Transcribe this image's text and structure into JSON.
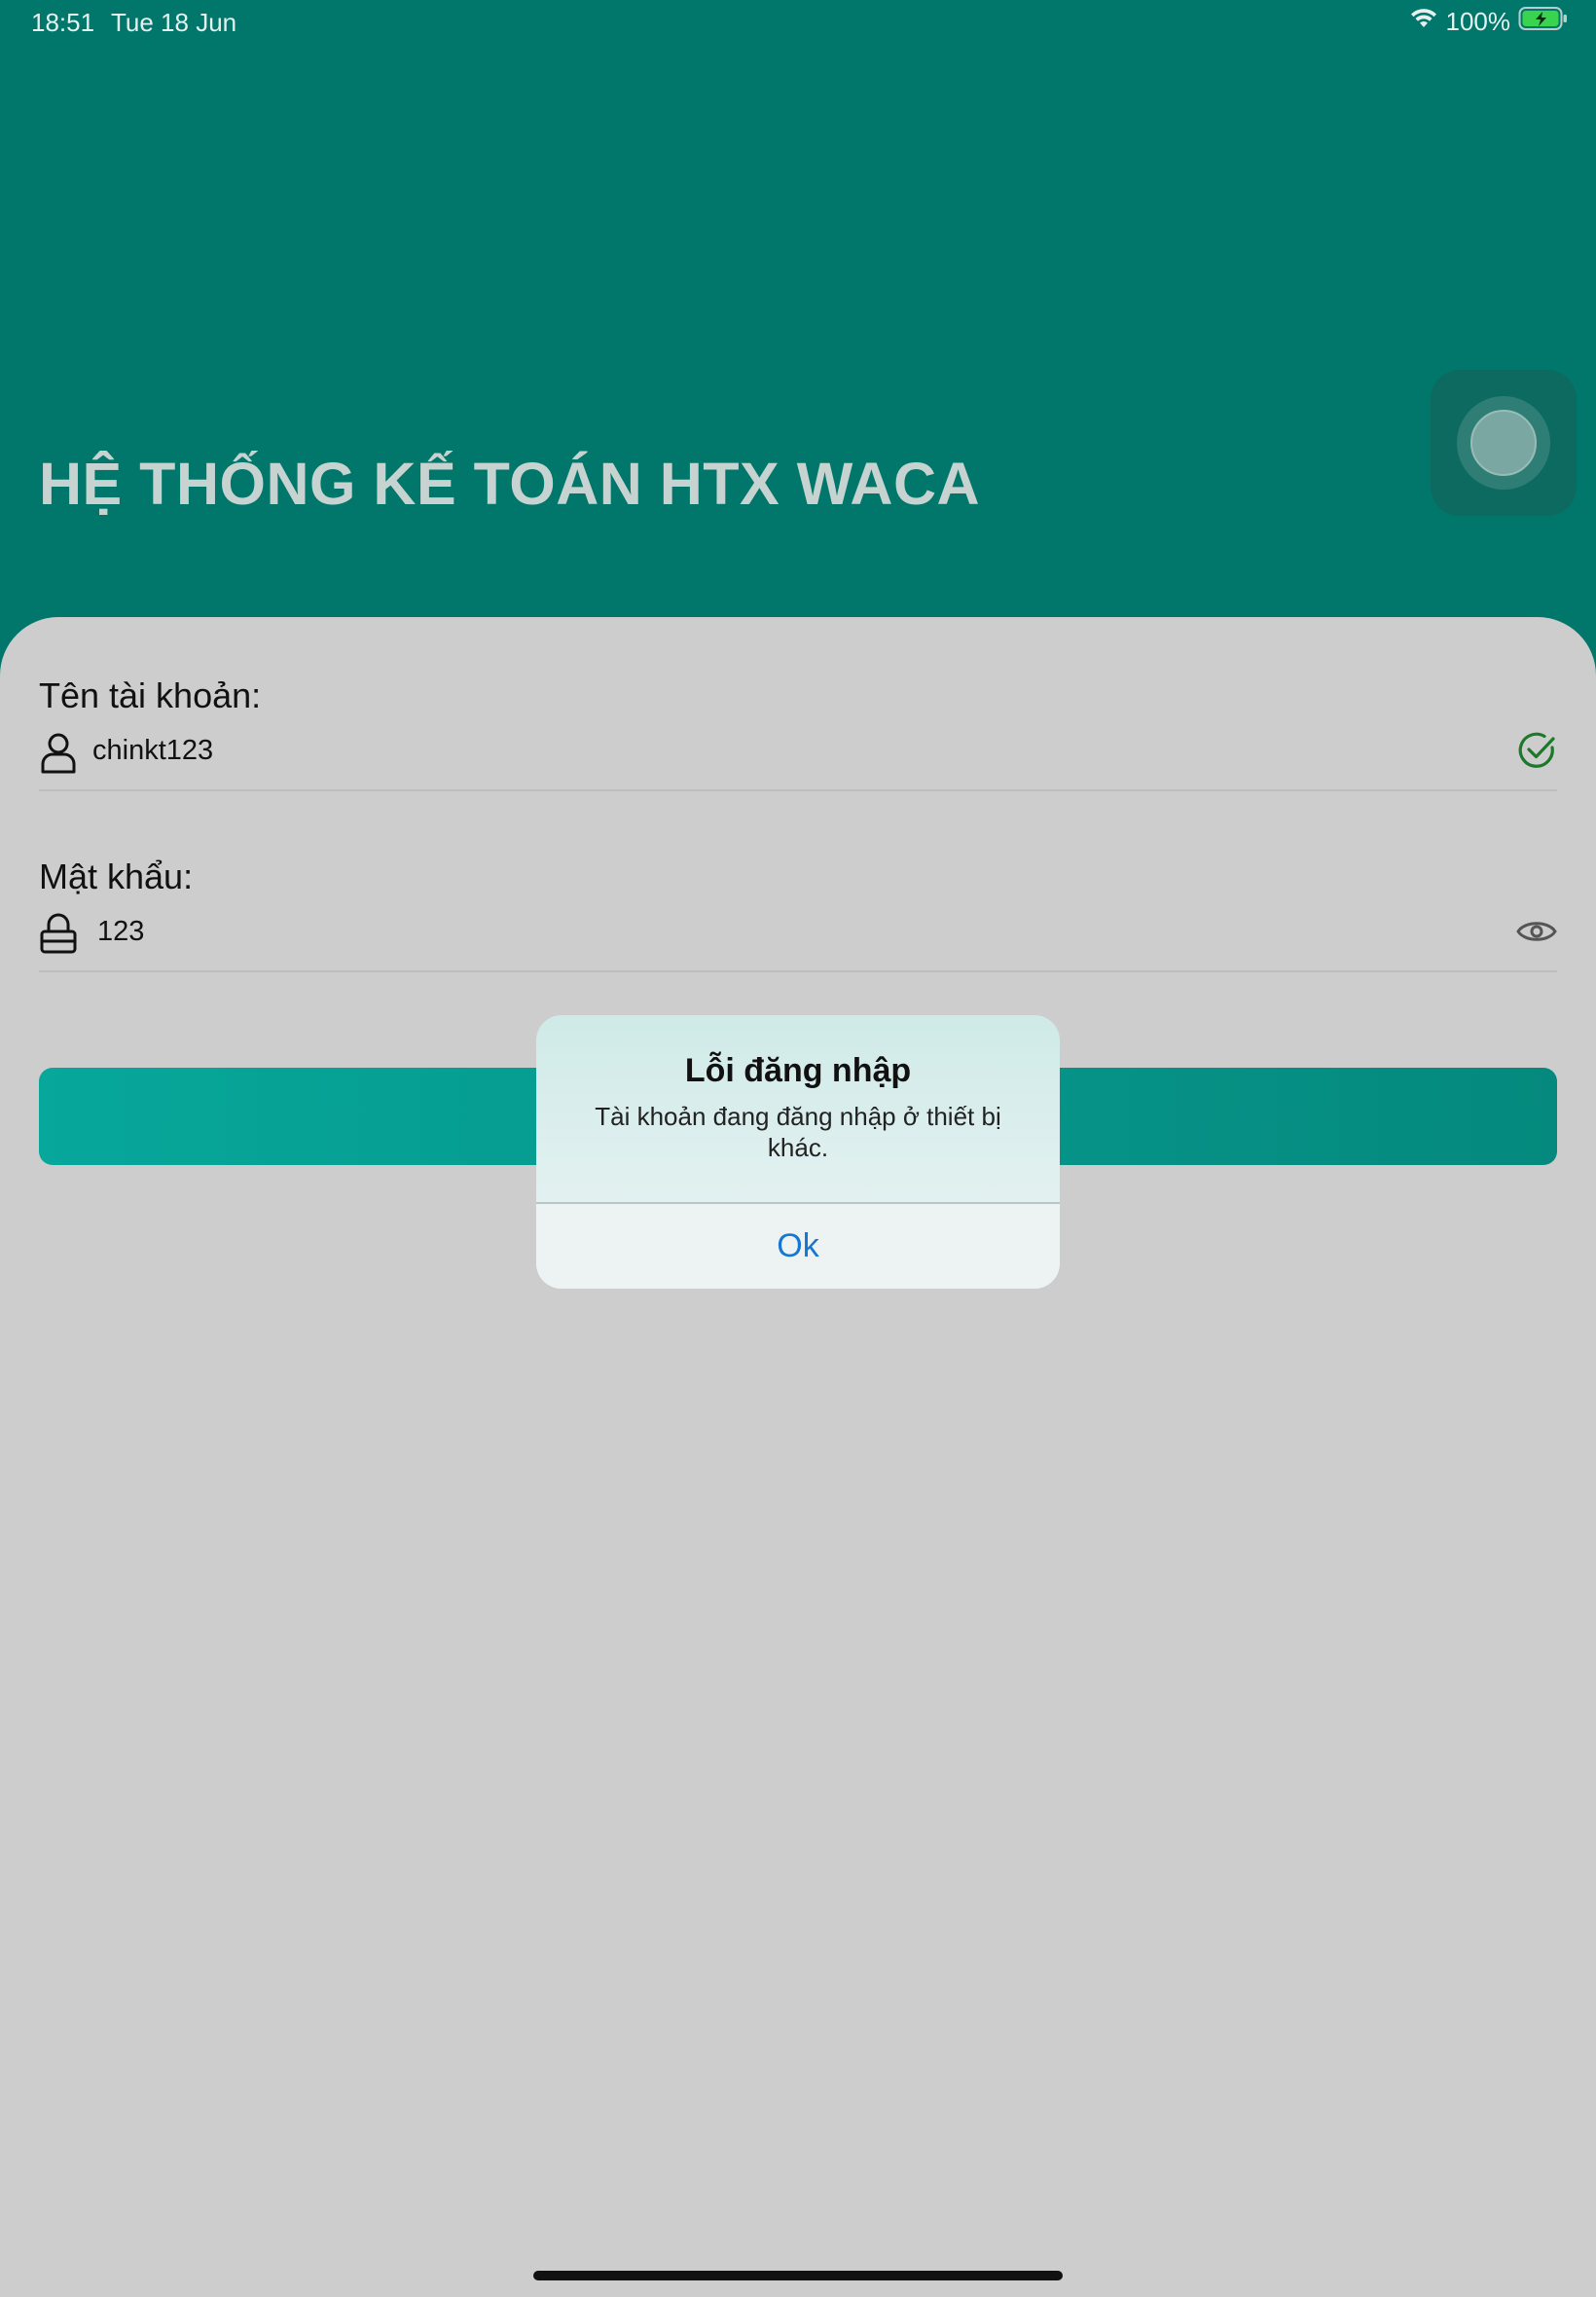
{
  "status_bar": {
    "time": "18:51",
    "date": "Tue 18 Jun",
    "battery": "100%"
  },
  "header": {
    "title": "HỆ THỐNG KẾ TOÁN HTX WACA",
    "background_color": "#01776b"
  },
  "form": {
    "username_label": "Tên tài khoản:",
    "username_value": "chinkt123",
    "username_icon": "user-icon",
    "username_status_icon": "check-circle-icon",
    "password_label": "Mật khẩu:",
    "password_value": "123",
    "password_icon": "lock-icon",
    "password_toggle_icon": "eye-icon"
  },
  "alert": {
    "title": "Lỗi đăng nhập",
    "message": "Tài khoản đang đăng nhập ở thiết bị khác.",
    "ok_label": "Ok",
    "ok_color": "#1677d2"
  }
}
